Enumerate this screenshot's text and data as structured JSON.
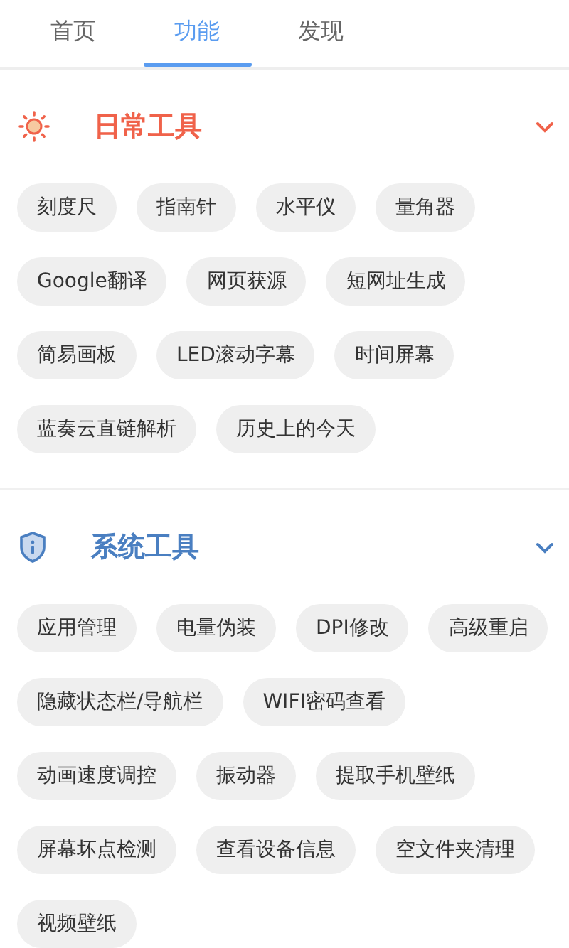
{
  "tabs": [
    {
      "label": "首页",
      "selected": false
    },
    {
      "label": "功能",
      "selected": true
    },
    {
      "label": "发现",
      "selected": false
    }
  ],
  "sections": [
    {
      "title": "日常工具",
      "kind": "sun",
      "color": "#f0624a",
      "expanded": true,
      "items": [
        "刻度尺",
        "指南针",
        "水平仪",
        "量角器",
        "Google翻译",
        "网页获源",
        "短网址生成",
        "简易画板",
        "LED滚动字幕",
        "时间屏幕",
        "蓝奏云直链解析",
        "历史上的今天"
      ]
    },
    {
      "title": "系统工具",
      "kind": "shield",
      "color": "#4a7fc1",
      "expanded": true,
      "items": [
        "应用管理",
        "电量伪装",
        "DPI修改",
        "高级重启",
        "隐藏状态栏/导航栏",
        "WIFI密码查看",
        "动画速度调控",
        "振动器",
        "提取手机壁纸",
        "屏幕坏点检测",
        "查看设备信息",
        "空文件夹清理",
        "视频壁纸"
      ]
    }
  ]
}
